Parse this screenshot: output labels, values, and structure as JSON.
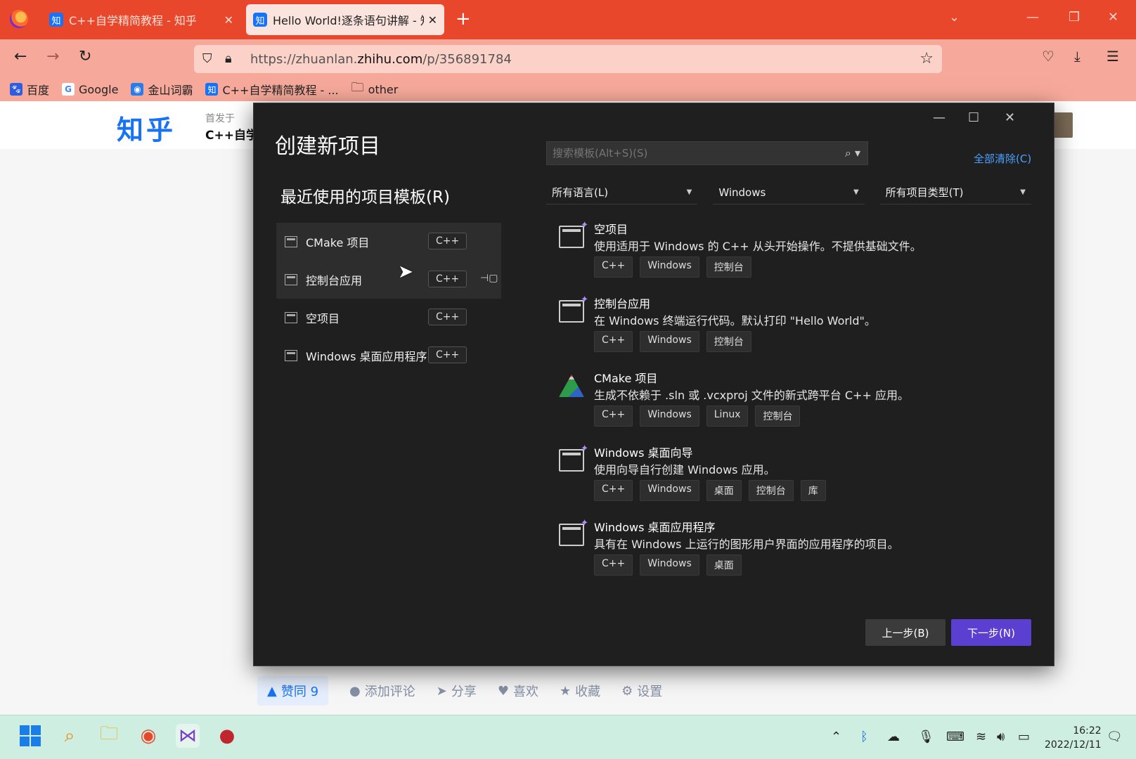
{
  "browser": {
    "tabs": [
      {
        "title": "C++自学精简教程 - 知乎",
        "favicon": "知",
        "active": false
      },
      {
        "title": "Hello World!逐条语句讲解 - 知",
        "favicon": "知",
        "active": true
      }
    ],
    "url_prefix": "https://zhuanlan.",
    "url_domain": "zhihu.com",
    "url_path": "/p/356891784",
    "bookmarks": [
      {
        "label": "百度",
        "icon": "baidu-icon"
      },
      {
        "label": "Google",
        "icon": "google-icon"
      },
      {
        "label": "金山词霸",
        "icon": "iciba-icon"
      },
      {
        "label": "C++自学精简教程 - ...",
        "icon": "zhihu-icon"
      },
      {
        "label": "other",
        "icon": "folder-icon"
      }
    ]
  },
  "page": {
    "logo": "知乎",
    "first_published": "首发于",
    "column_name": "C++自学",
    "actions": {
      "vote": "赞同 9",
      "comment": "添加评论",
      "share": "分享",
      "like": "喜欢",
      "collect": "收藏",
      "settings": "设置"
    }
  },
  "dialog": {
    "title": "创建新项目",
    "recent_title": "最近使用的项目模板(R)",
    "recent": [
      {
        "name": "CMake 项目",
        "tag": "C++"
      },
      {
        "name": "控制台应用",
        "tag": "C++"
      },
      {
        "name": "空项目",
        "tag": "C++"
      },
      {
        "name": "Windows 桌面应用程序",
        "tag": "C++"
      }
    ],
    "search_placeholder": "搜索模板(Alt+S)(S)",
    "clear_all": "全部清除(C)",
    "filters": {
      "language": "所有语言(L)",
      "platform": "Windows",
      "project_type": "所有项目类型(T)"
    },
    "templates": [
      {
        "name": "空项目",
        "desc": "使用适用于 Windows 的 C++ 从头开始操作。不提供基础文件。",
        "tags": [
          "C++",
          "Windows",
          "控制台"
        ]
      },
      {
        "name": "控制台应用",
        "desc": "在 Windows 终端运行代码。默认打印 \"Hello World\"。",
        "tags": [
          "C++",
          "Windows",
          "控制台"
        ]
      },
      {
        "name": "CMake 项目",
        "desc": "生成不依赖于 .sln 或 .vcxproj 文件的新式跨平台 C++ 应用。",
        "tags": [
          "C++",
          "Windows",
          "Linux",
          "控制台"
        ]
      },
      {
        "name": "Windows 桌面向导",
        "desc": "使用向导自行创建 Windows 应用。",
        "tags": [
          "C++",
          "Windows",
          "桌面",
          "控制台",
          "库"
        ]
      },
      {
        "name": "Windows 桌面应用程序",
        "desc": "具有在 Windows 上运行的图形用户界面的应用程序的项目。",
        "tags": [
          "C++",
          "Windows",
          "桌面"
        ]
      }
    ],
    "back_button": "上一步(B)",
    "next_button": "下一步(N)"
  },
  "taskbar": {
    "time": "16:22",
    "date": "2022/12/11"
  },
  "colors": {
    "browser_accent": "#e9472b",
    "dialog_bg": "#1f1f1f",
    "next_button": "#5b3fd1",
    "link": "#4aa0ff",
    "zhihu_blue": "#1772f6"
  }
}
